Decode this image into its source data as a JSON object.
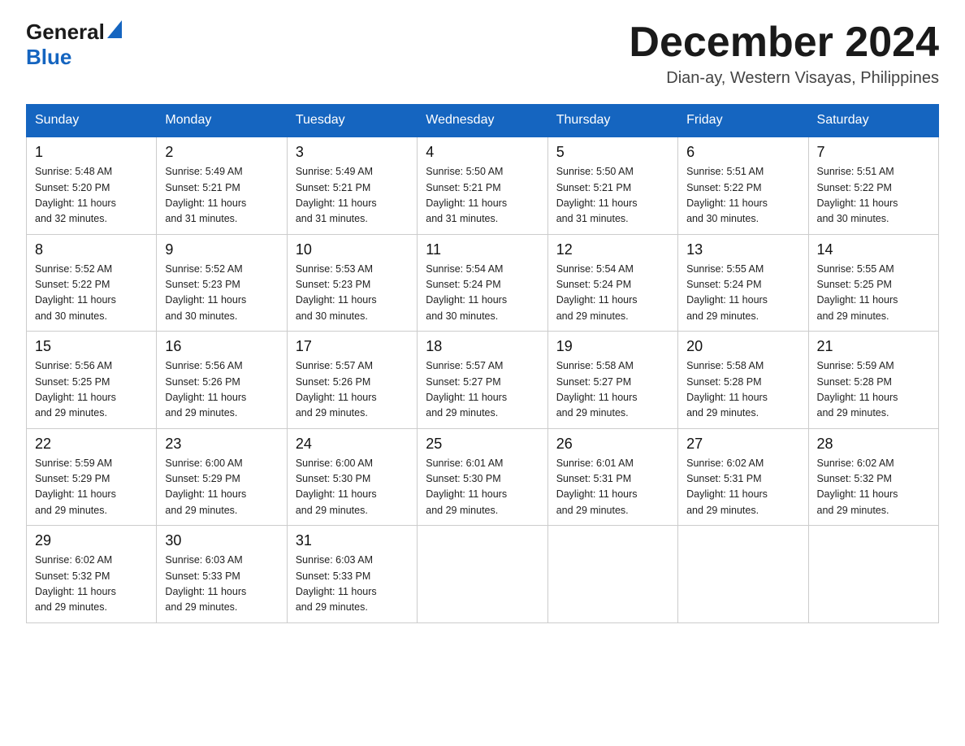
{
  "header": {
    "logo_general": "General",
    "logo_blue": "Blue",
    "month_title": "December 2024",
    "location": "Dian-ay, Western Visayas, Philippines"
  },
  "days_of_week": [
    "Sunday",
    "Monday",
    "Tuesday",
    "Wednesday",
    "Thursday",
    "Friday",
    "Saturday"
  ],
  "weeks": [
    [
      {
        "num": "1",
        "sunrise": "5:48 AM",
        "sunset": "5:20 PM",
        "daylight": "11 hours and 32 minutes."
      },
      {
        "num": "2",
        "sunrise": "5:49 AM",
        "sunset": "5:21 PM",
        "daylight": "11 hours and 31 minutes."
      },
      {
        "num": "3",
        "sunrise": "5:49 AM",
        "sunset": "5:21 PM",
        "daylight": "11 hours and 31 minutes."
      },
      {
        "num": "4",
        "sunrise": "5:50 AM",
        "sunset": "5:21 PM",
        "daylight": "11 hours and 31 minutes."
      },
      {
        "num": "5",
        "sunrise": "5:50 AM",
        "sunset": "5:21 PM",
        "daylight": "11 hours and 31 minutes."
      },
      {
        "num": "6",
        "sunrise": "5:51 AM",
        "sunset": "5:22 PM",
        "daylight": "11 hours and 30 minutes."
      },
      {
        "num": "7",
        "sunrise": "5:51 AM",
        "sunset": "5:22 PM",
        "daylight": "11 hours and 30 minutes."
      }
    ],
    [
      {
        "num": "8",
        "sunrise": "5:52 AM",
        "sunset": "5:22 PM",
        "daylight": "11 hours and 30 minutes."
      },
      {
        "num": "9",
        "sunrise": "5:52 AM",
        "sunset": "5:23 PM",
        "daylight": "11 hours and 30 minutes."
      },
      {
        "num": "10",
        "sunrise": "5:53 AM",
        "sunset": "5:23 PM",
        "daylight": "11 hours and 30 minutes."
      },
      {
        "num": "11",
        "sunrise": "5:54 AM",
        "sunset": "5:24 PM",
        "daylight": "11 hours and 30 minutes."
      },
      {
        "num": "12",
        "sunrise": "5:54 AM",
        "sunset": "5:24 PM",
        "daylight": "11 hours and 29 minutes."
      },
      {
        "num": "13",
        "sunrise": "5:55 AM",
        "sunset": "5:24 PM",
        "daylight": "11 hours and 29 minutes."
      },
      {
        "num": "14",
        "sunrise": "5:55 AM",
        "sunset": "5:25 PM",
        "daylight": "11 hours and 29 minutes."
      }
    ],
    [
      {
        "num": "15",
        "sunrise": "5:56 AM",
        "sunset": "5:25 PM",
        "daylight": "11 hours and 29 minutes."
      },
      {
        "num": "16",
        "sunrise": "5:56 AM",
        "sunset": "5:26 PM",
        "daylight": "11 hours and 29 minutes."
      },
      {
        "num": "17",
        "sunrise": "5:57 AM",
        "sunset": "5:26 PM",
        "daylight": "11 hours and 29 minutes."
      },
      {
        "num": "18",
        "sunrise": "5:57 AM",
        "sunset": "5:27 PM",
        "daylight": "11 hours and 29 minutes."
      },
      {
        "num": "19",
        "sunrise": "5:58 AM",
        "sunset": "5:27 PM",
        "daylight": "11 hours and 29 minutes."
      },
      {
        "num": "20",
        "sunrise": "5:58 AM",
        "sunset": "5:28 PM",
        "daylight": "11 hours and 29 minutes."
      },
      {
        "num": "21",
        "sunrise": "5:59 AM",
        "sunset": "5:28 PM",
        "daylight": "11 hours and 29 minutes."
      }
    ],
    [
      {
        "num": "22",
        "sunrise": "5:59 AM",
        "sunset": "5:29 PM",
        "daylight": "11 hours and 29 minutes."
      },
      {
        "num": "23",
        "sunrise": "6:00 AM",
        "sunset": "5:29 PM",
        "daylight": "11 hours and 29 minutes."
      },
      {
        "num": "24",
        "sunrise": "6:00 AM",
        "sunset": "5:30 PM",
        "daylight": "11 hours and 29 minutes."
      },
      {
        "num": "25",
        "sunrise": "6:01 AM",
        "sunset": "5:30 PM",
        "daylight": "11 hours and 29 minutes."
      },
      {
        "num": "26",
        "sunrise": "6:01 AM",
        "sunset": "5:31 PM",
        "daylight": "11 hours and 29 minutes."
      },
      {
        "num": "27",
        "sunrise": "6:02 AM",
        "sunset": "5:31 PM",
        "daylight": "11 hours and 29 minutes."
      },
      {
        "num": "28",
        "sunrise": "6:02 AM",
        "sunset": "5:32 PM",
        "daylight": "11 hours and 29 minutes."
      }
    ],
    [
      {
        "num": "29",
        "sunrise": "6:02 AM",
        "sunset": "5:32 PM",
        "daylight": "11 hours and 29 minutes."
      },
      {
        "num": "30",
        "sunrise": "6:03 AM",
        "sunset": "5:33 PM",
        "daylight": "11 hours and 29 minutes."
      },
      {
        "num": "31",
        "sunrise": "6:03 AM",
        "sunset": "5:33 PM",
        "daylight": "11 hours and 29 minutes."
      },
      null,
      null,
      null,
      null
    ]
  ],
  "labels": {
    "sunrise": "Sunrise:",
    "sunset": "Sunset:",
    "daylight": "Daylight:"
  }
}
